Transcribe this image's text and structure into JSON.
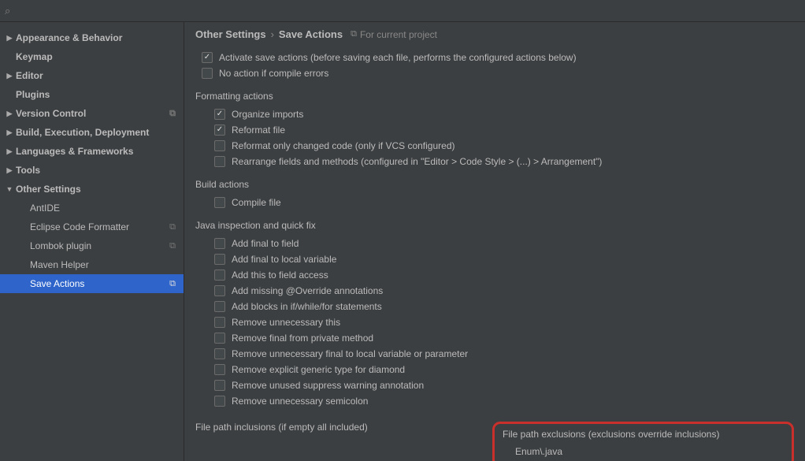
{
  "search": {
    "placeholder": ""
  },
  "sidebar": [
    {
      "label": "Appearance & Behavior",
      "arrow": "▶",
      "bold": true
    },
    {
      "label": "Keymap",
      "arrow": "",
      "bold": true
    },
    {
      "label": "Editor",
      "arrow": "▶",
      "bold": true
    },
    {
      "label": "Plugins",
      "arrow": "",
      "bold": true
    },
    {
      "label": "Version Control",
      "arrow": "▶",
      "bold": true,
      "copy": true
    },
    {
      "label": "Build, Execution, Deployment",
      "arrow": "▶",
      "bold": true
    },
    {
      "label": "Languages & Frameworks",
      "arrow": "▶",
      "bold": true
    },
    {
      "label": "Tools",
      "arrow": "▶",
      "bold": true
    },
    {
      "label": "Other Settings",
      "arrow": "▼",
      "bold": true
    },
    {
      "label": "AntIDE",
      "arrow": "",
      "child": true
    },
    {
      "label": "Eclipse Code Formatter",
      "arrow": "",
      "child": true,
      "copy": true
    },
    {
      "label": "Lombok plugin",
      "arrow": "",
      "child": true,
      "copy": true
    },
    {
      "label": "Maven Helper",
      "arrow": "",
      "child": true
    },
    {
      "label": "Save Actions",
      "arrow": "",
      "child": true,
      "selected": true,
      "copy": true
    }
  ],
  "breadcrumb": {
    "parent": "Other Settings",
    "current": "Save Actions",
    "scope": "For current project"
  },
  "topChecks": [
    {
      "label": "Activate save actions (before saving each file, performs the configured actions below)",
      "checked": true
    },
    {
      "label": "No action if compile errors",
      "checked": false
    }
  ],
  "sections": [
    {
      "title": "Formatting actions",
      "items": [
        {
          "label": "Organize imports",
          "checked": true
        },
        {
          "label": "Reformat file",
          "checked": true
        },
        {
          "label": "Reformat only changed code (only if VCS configured)",
          "checked": false
        },
        {
          "label": "Rearrange fields and methods (configured in \"Editor > Code Style > (...) > Arrangement\")",
          "checked": false
        }
      ]
    },
    {
      "title": "Build actions",
      "items": [
        {
          "label": "Compile file",
          "checked": false
        }
      ]
    },
    {
      "title": "Java inspection and quick fix",
      "items": [
        {
          "label": "Add final to field",
          "checked": false
        },
        {
          "label": "Add final to local variable",
          "checked": false
        },
        {
          "label": "Add this to field access",
          "checked": false
        },
        {
          "label": "Add missing @Override annotations",
          "checked": false
        },
        {
          "label": "Add blocks in if/while/for statements",
          "checked": false
        },
        {
          "label": "Remove unnecessary this",
          "checked": false
        },
        {
          "label": "Remove final from private method",
          "checked": false
        },
        {
          "label": "Remove unnecessary final to local variable or parameter",
          "checked": false
        },
        {
          "label": "Remove explicit generic type for diamond",
          "checked": false
        },
        {
          "label": "Remove unused suppress warning annotation",
          "checked": false
        },
        {
          "label": "Remove unnecessary semicolon",
          "checked": false
        }
      ]
    }
  ],
  "inclusions": {
    "title": "File path inclusions (if empty all included)"
  },
  "exclusions": {
    "title": "File path exclusions (exclusions override inclusions)",
    "value": "Enum\\.java"
  }
}
